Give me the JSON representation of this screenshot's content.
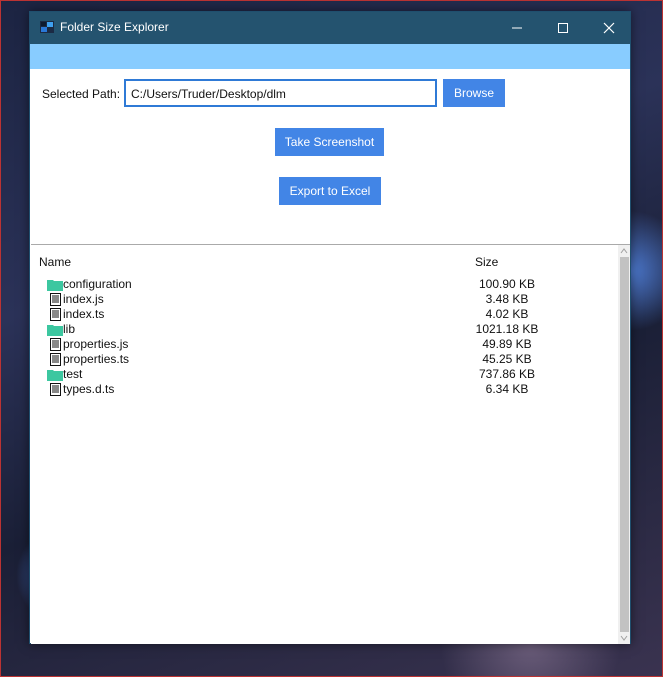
{
  "window": {
    "title": "Folder Size Explorer",
    "title_bar_color": "#24536f",
    "accent_strip_color": "#88ccff",
    "controls": [
      "minimize-icon",
      "maximize-icon",
      "close-icon"
    ]
  },
  "path": {
    "label": "Selected Path:",
    "value": "C:/Users/Truder/Desktop/dlm"
  },
  "buttons": {
    "browse": "Browse",
    "screenshot": "Take Screenshot",
    "export": "Export to Excel",
    "color": "#4285e6"
  },
  "table": {
    "columns": [
      "Name",
      "Size"
    ],
    "rows": [
      {
        "name": "configuration",
        "size": "100.90 KB",
        "type": "folder"
      },
      {
        "name": "index.js",
        "size": "3.48 KB",
        "type": "file"
      },
      {
        "name": "index.ts",
        "size": "4.02 KB",
        "type": "file"
      },
      {
        "name": "lib",
        "size": "1021.18 KB",
        "type": "folder"
      },
      {
        "name": "properties.js",
        "size": "49.89 KB",
        "type": "file"
      },
      {
        "name": "properties.ts",
        "size": "45.25 KB",
        "type": "file"
      },
      {
        "name": "test",
        "size": "737.86 KB",
        "type": "folder"
      },
      {
        "name": "types.d.ts",
        "size": "6.34 KB",
        "type": "file"
      }
    ],
    "folder_icon_color": "#3cc7a0"
  }
}
